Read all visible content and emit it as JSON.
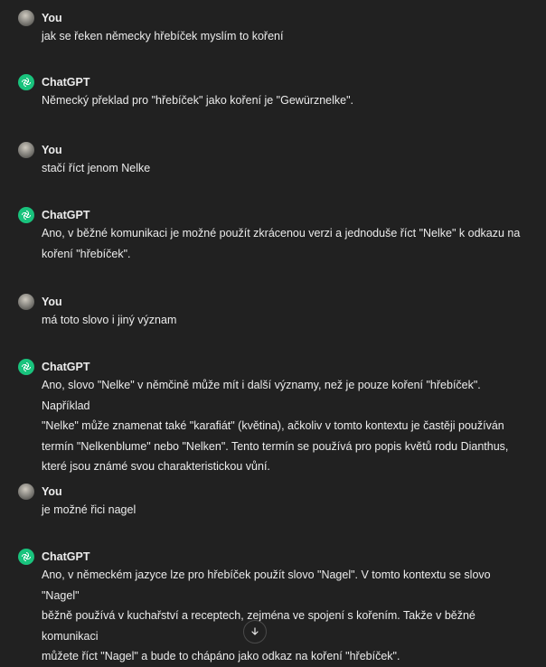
{
  "messages": [
    {
      "author": "You",
      "role": "user",
      "lines": [
        "jak se řeken německy hřebíček myslím to koření"
      ]
    },
    {
      "author": "ChatGPT",
      "role": "assistant",
      "lines": [
        "Německý překlad pro \"hřebíček\" jako koření je \"Gewürznelke\"."
      ]
    },
    {
      "author": "You",
      "role": "user",
      "lines": [
        "stačí říct jenom Nelke"
      ]
    },
    {
      "author": "ChatGPT",
      "role": "assistant",
      "lines": [
        "Ano, v běžné komunikaci je možné použít zkrácenou verzi a jednoduše říct \"Nelke\" k odkazu na",
        "koření \"hřebíček\"."
      ]
    },
    {
      "author": "You",
      "role": "user",
      "lines": [
        "má toto slovo i jiný význam"
      ]
    },
    {
      "author": "ChatGPT",
      "role": "assistant",
      "lines": [
        "Ano, slovo \"Nelke\" v němčině může mít i další významy, než je pouze koření \"hřebíček\". Například",
        "\"Nelke\" může znamenat také \"karafiát\" (květina), ačkoliv v tomto kontextu je častěji používán",
        "termín \"Nelkenblume\" nebo \"Nelken\". Tento termín se používá pro popis květů rodu Dianthus,",
        "které jsou známé svou charakteristickou vůní."
      ]
    },
    {
      "author": "You",
      "role": "user",
      "lines": [
        "je možné řici nagel"
      ]
    },
    {
      "author": "ChatGPT",
      "role": "assistant",
      "lines": [
        "Ano, v německém jazyce lze pro hřebíček použít slovo \"Nagel\". V tomto kontextu se slovo \"Nagel\"",
        "běžně používá v kuchařství a receptech, zejména ve spojení s kořením. Takže v běžné komunikaci",
        "můžete říct \"Nagel\" a bude to chápáno jako odkaz na koření \"hřebíček\"."
      ]
    }
  ],
  "icons": {
    "assistant_avatar": "openai-logo-icon",
    "user_avatar": "user-photo-avatar",
    "scroll_down": "arrow-down-icon"
  },
  "colors": {
    "background": "#212121",
    "text": "#ececec",
    "assistant_avatar_bg": "#19c37d"
  }
}
